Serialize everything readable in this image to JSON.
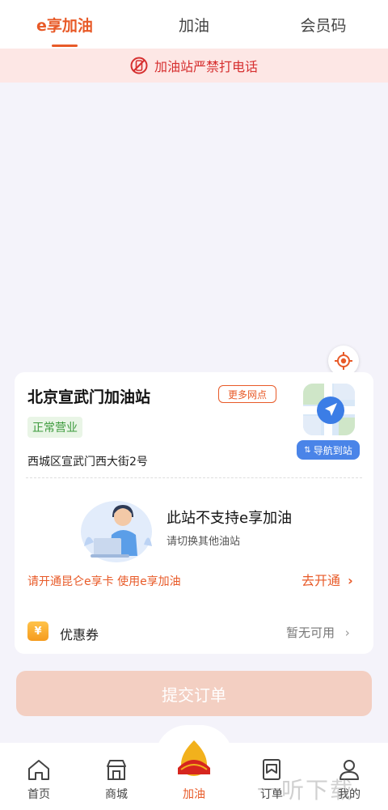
{
  "tabs": [
    {
      "label": "e享加油",
      "active": true
    },
    {
      "label": "加油",
      "active": false
    },
    {
      "label": "会员码",
      "active": false
    }
  ],
  "warning": {
    "text": "加油站严禁打电话",
    "icon": "no-phone-icon"
  },
  "station": {
    "name": "北京宣武门加油站",
    "more_label": "更多网点",
    "status": "正常营业",
    "address": "西城区宣武门西大街2号",
    "nav_label": "导航到站"
  },
  "notice": {
    "title": "此站不支持e享加油",
    "subtitle": "请切换其他油站",
    "promo": "请开通昆仑e享卡 使用e享加油",
    "action": "去开通"
  },
  "coupon": {
    "label": "优惠券",
    "value": "暂无可用",
    "icon": "coupon-yuan-icon",
    "icon_text": "¥"
  },
  "submit": {
    "label": "提交订单"
  },
  "bottom_nav": [
    {
      "label": "首页",
      "icon": "home-icon"
    },
    {
      "label": "商城",
      "icon": "store-icon"
    },
    {
      "label": "加油",
      "icon": "petrochina-logo-icon",
      "active": true
    },
    {
      "label": "订单",
      "icon": "order-icon"
    },
    {
      "label": "我的",
      "icon": "profile-icon"
    }
  ],
  "watermark": "一听下载",
  "colors": {
    "accent": "#e85a28",
    "warning_bg": "#fde7e5",
    "warning_text": "#d62f2f",
    "status_green": "#3c9a3c",
    "nav_blue": "#4a84e8"
  }
}
